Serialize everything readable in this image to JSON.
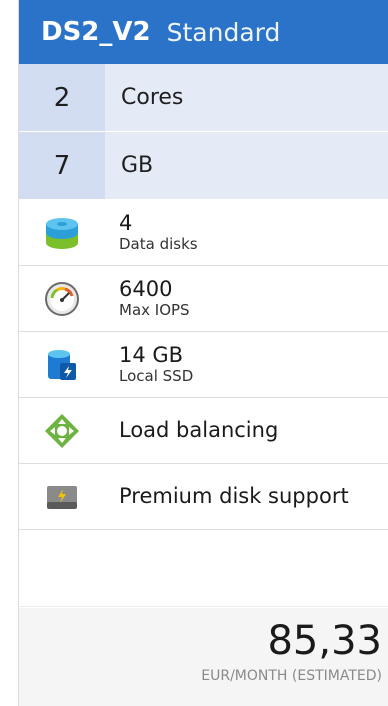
{
  "header": {
    "size": "DS2_V2",
    "tier": "Standard",
    "accent": "#2b73c8"
  },
  "specs": {
    "cores": {
      "value": "2",
      "label": "Cores"
    },
    "memory": {
      "value": "7",
      "label": "GB"
    }
  },
  "features": [
    {
      "value": "4",
      "label": "Data disks",
      "icon": "data-disks-icon"
    },
    {
      "value": "6400",
      "label": "Max IOPS",
      "icon": "gauge-icon"
    },
    {
      "value": "14 GB",
      "label": "Local SSD",
      "icon": "local-ssd-icon"
    },
    {
      "label": "Load balancing",
      "icon": "load-balancer-icon"
    },
    {
      "label": "Premium disk support",
      "icon": "premium-disk-icon"
    }
  ],
  "price": {
    "amount": "85,33",
    "unit": "EUR/MONTH (ESTIMATED)"
  }
}
